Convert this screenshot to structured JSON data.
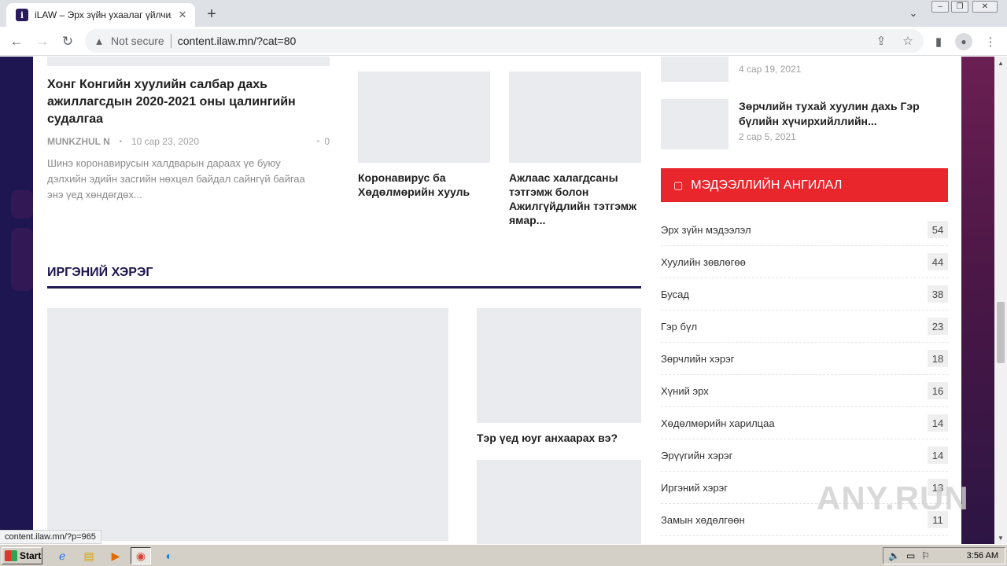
{
  "browser": {
    "tab_title": "iLAW – Эрх зүйн ухаалаг үйлчилгээ",
    "tab_favicon_letter": "i",
    "not_secure_label": "Not secure",
    "url": "content.ilaw.mn/?cat=80",
    "status_url": "content.ilaw.mn/?p=965"
  },
  "posts_top": {
    "main": {
      "title": "Хонг Конгийн хуулийн салбар дахь ажиллагсдын 2020-2021 оны цалингийн судалгаа",
      "author": "MUNKZHUL N",
      "date": "10 сар 23, 2020",
      "comments": "0",
      "excerpt": "Шинэ коронавирусын халдварын дараах үе буюу дэлхийн эдийн засгийн нөхцөл байдал сайнгүй байгаа энэ үед хөндөгдөх..."
    },
    "small": [
      {
        "title": "Коронавирус ба Хөдөлмөрийн хууль"
      },
      {
        "title": "Ажлаас халагдсаны тэтгэмж болон Ажилгүйдлийн тэтгэмж ямар..."
      }
    ]
  },
  "section": {
    "title": "ИРГЭНИЙ ХЭРЭГ",
    "side_post_title": "Тэр үед юуг анхаарах вэ?"
  },
  "sidebar": {
    "recent": [
      {
        "date": "4 сар 19, 2021"
      },
      {
        "title": "Зөрчлийн тухай хуулин дахь Гэр бүлийн хүчирхийллийн...",
        "date": "2 сар 5, 2021"
      }
    ],
    "categories_heading": "МЭДЭЭЛЛИЙН АНГИЛАЛ",
    "categories": [
      {
        "name": "Эрх зүйн мэдээлэл",
        "count": "54"
      },
      {
        "name": "Хуулийн зөвлөгөө",
        "count": "44"
      },
      {
        "name": "Бусад",
        "count": "38"
      },
      {
        "name": "Гэр бүл",
        "count": "23"
      },
      {
        "name": "Зөрчлийн хэрэг",
        "count": "18"
      },
      {
        "name": "Хүний эрх",
        "count": "16"
      },
      {
        "name": "Хөдөлмөрийн харилцаа",
        "count": "14"
      },
      {
        "name": "Эрүүгийн хэрэг",
        "count": "14"
      },
      {
        "name": "Иргэний хэрэг",
        "count": "13"
      },
      {
        "name": "Замын хөдөлгөөн",
        "count": "11"
      }
    ]
  },
  "watermark": "ANY.RUN",
  "taskbar": {
    "start_label": "Start",
    "clock": "3:56 AM"
  }
}
